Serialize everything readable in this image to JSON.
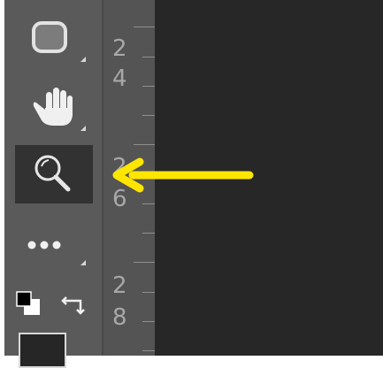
{
  "toolbar": {
    "tools": [
      {
        "name": "shape-tool",
        "icon": "rounded-rectangle-icon"
      },
      {
        "name": "hand-tool",
        "icon": "hand-icon"
      },
      {
        "name": "zoom-tool",
        "icon": "magnifier-icon",
        "active": true
      },
      {
        "name": "more-tools",
        "icon": "ellipsis-icon"
      }
    ],
    "default_colors_icon": "default-colors-icon",
    "swap_colors_icon": "swap-colors-icon",
    "foreground_color": "#262626"
  },
  "ruler": {
    "labels": [
      {
        "text": "2"
      },
      {
        "text": "4"
      },
      {
        "text": "2"
      },
      {
        "text": "6"
      },
      {
        "text": "2"
      },
      {
        "text": "8"
      }
    ]
  },
  "annotation": {
    "arrow_color": "#ffe600",
    "target": "zoom-tool"
  }
}
